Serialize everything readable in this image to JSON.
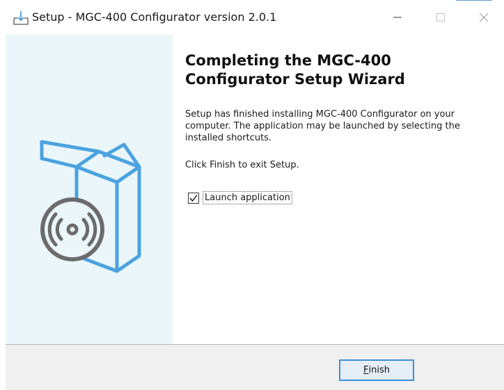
{
  "window": {
    "title": "Setup - MGC-400 Configurator version 2.0.1",
    "icons": {
      "app": "setup-install-icon",
      "minimize": "minimize-icon",
      "maximize": "maximize-icon",
      "close": "close-icon"
    }
  },
  "banner": {
    "image": "software-box-disc-icon",
    "colors": {
      "background": "#eaf6fa",
      "box": "#4aa3df",
      "disc": "#6b6b6b"
    }
  },
  "wizard": {
    "heading_line1": "Completing the MGC-400",
    "heading_line2": "Configurator Setup Wizard",
    "message_line1": "Setup has finished installing MGC-400 Configurator on your",
    "message_line2": "computer. The application may be launched by selecting the",
    "message_line3": "installed shortcuts.",
    "finish_instruction": "Click Finish to exit Setup.",
    "launch_checkbox": {
      "label": "Launch application",
      "checked": true
    }
  },
  "footer": {
    "finish_button": {
      "mnemonic": "F",
      "rest": "inish"
    }
  }
}
